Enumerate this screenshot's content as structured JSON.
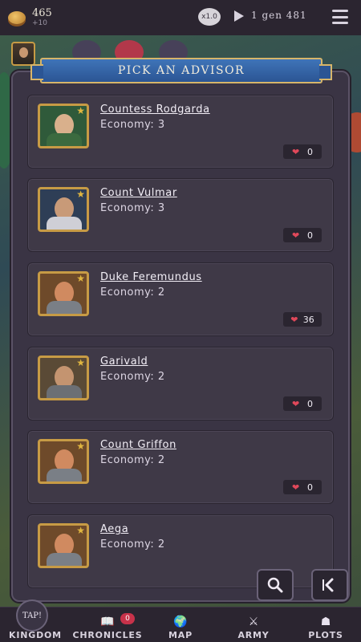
{
  "header": {
    "gold": "465",
    "gold_income": "+10",
    "speed": "x1.0",
    "date": "1 gen 481",
    "icons": [
      "coin-icon",
      "play-icon",
      "menu-icon"
    ]
  },
  "dialog": {
    "title": "PICK AN ADVISOR"
  },
  "advisors": [
    {
      "name": "Countess Rodgarda",
      "stat": "Economy: 3",
      "likes": "0",
      "palette": {
        "bg": "#2f5a3a",
        "face": "#d9b08c",
        "body": "#3b6a3f"
      }
    },
    {
      "name": "Count Vulmar",
      "stat": "Economy: 3",
      "likes": "0",
      "palette": {
        "bg": "#2e3e56",
        "face": "#c89a78",
        "body": "#cfcfd6"
      }
    },
    {
      "name": "Duke Feremundus",
      "stat": "Economy: 2",
      "likes": "36",
      "palette": {
        "bg": "#6e4a2a",
        "face": "#d08a60",
        "body": "#7a7f86"
      }
    },
    {
      "name": "Garivald",
      "stat": "Economy: 2",
      "likes": "0",
      "palette": {
        "bg": "#5a4a36",
        "face": "#c49470",
        "body": "#6c6f74"
      }
    },
    {
      "name": "Count Griffon",
      "stat": "Economy: 2",
      "likes": "0",
      "palette": {
        "bg": "#6e4a2a",
        "face": "#d08a60",
        "body": "#7a7f86"
      }
    },
    {
      "name": "Aega",
      "stat": "Economy: 2",
      "likes": "",
      "palette": {
        "bg": "#6e4a2a",
        "face": "#d08a60",
        "body": "#7a7f86"
      }
    }
  ],
  "controls": {
    "search_icon": "search-icon",
    "back_icon": "back-icon"
  },
  "nav": {
    "tap_label": "TAP!",
    "kingdom": "KINGDOM",
    "chronicles": "CHRONICLES",
    "chronicles_badge": "0",
    "map": "MAP",
    "army": "ARMY",
    "plots": "PLOTS"
  },
  "colors": {
    "banner": "#3f74b8",
    "gold_trim": "#d7b56a",
    "heart": "#e0485a",
    "panel": "#3a3444"
  }
}
